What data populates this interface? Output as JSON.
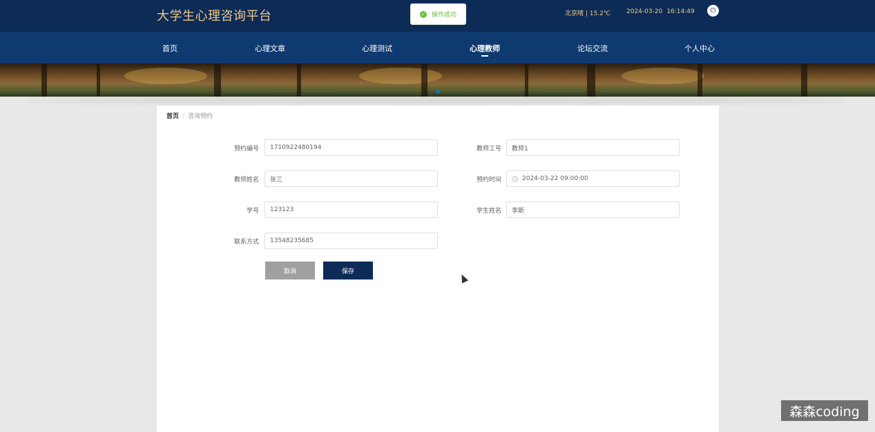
{
  "header": {
    "brand": "大学生心理咨询平台",
    "weather": "北京晴 | 15.2℃",
    "date": "2024-03-20",
    "time": "16:14:49",
    "power_icon": "power-icon"
  },
  "toast": {
    "message": "操作成功",
    "icon": "check-circle-icon",
    "color": "#67c23a"
  },
  "nav": {
    "items": [
      {
        "label": "首页"
      },
      {
        "label": "心理文章"
      },
      {
        "label": "心理测试"
      },
      {
        "label": "心理教师",
        "active": true
      },
      {
        "label": "论坛交流"
      },
      {
        "label": "个人中心"
      }
    ]
  },
  "breadcrumb": {
    "home": "首页",
    "separator": "/",
    "current": "咨询预约"
  },
  "form": {
    "booking_no": {
      "label": "预约编号",
      "value": "1710922480194"
    },
    "teacher_id": {
      "label": "教师工号",
      "value": "教师1"
    },
    "teacher_name": {
      "label": "教师姓名",
      "value": "张三"
    },
    "booking_time": {
      "label": "预约时间",
      "value": "2024-03-22 09:00:00"
    },
    "student_no": {
      "label": "学号",
      "value": "123123"
    },
    "student_name": {
      "label": "学生姓名",
      "value": "李斯"
    },
    "contact": {
      "label": "联系方式",
      "value": "13548235685"
    },
    "cancel_label": "取消",
    "save_label": "保存"
  },
  "watermark": "森森coding",
  "colors": {
    "primary": "#0d2b57",
    "nav": "#0f3a70",
    "brand_text": "#f0c988",
    "success": "#67c23a"
  }
}
